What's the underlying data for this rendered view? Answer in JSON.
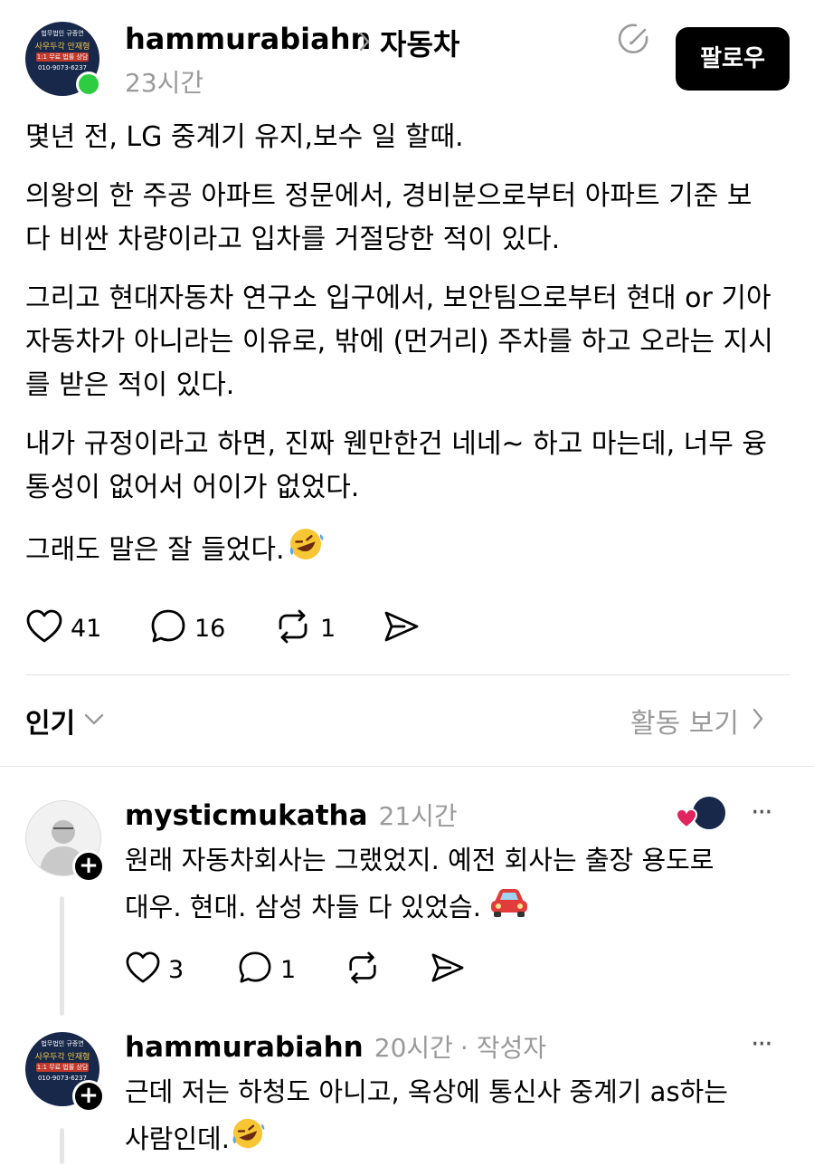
{
  "post": {
    "author": "hammurabiahn",
    "topic": "자동차",
    "time": "23시간",
    "follow_label": "팔로우",
    "avatar_text": {
      "logo": "법무법인 규종연",
      "name": "사우두각 안재형",
      "badge": "1:1 무료 법률 상담",
      "phone": "010-9073-6237"
    },
    "paragraphs": [
      "몇년 전, LG 중계기 유지,보수 일 할때.",
      "의왕의 한 주공 아파트 정문에서, 경비분으로부터 아파트 기준 보다 비싼 차량이라고 입차를 거절당한 적이 있다.",
      "그리고 현대자동차 연구소 입구에서, 보안팀으로부터 현대 or 기아자동차가 아니라는 이유로, 밖에 (먼거리) 주차를 하고 오라는 지시를 받은 적이 있다.",
      "내가 규정이라고 하면, 진짜 웬만한건 네네~ 하고 마는데, 너무 융통성이 없어서 어이가 없었다.",
      "그래도 말은 잘 들었다."
    ],
    "likes": "41",
    "comments": "16",
    "reposts": "1"
  },
  "sort": {
    "label": "인기",
    "activity_label": "활동 보기"
  },
  "replies": [
    {
      "author": "mysticmukatha",
      "time": "21시간",
      "text_line1": "원래 자동차회사는 그랬었지. 예전 회사는 출장 용도로",
      "text_line2": "대우. 현대. 삼성 차들 다 있었슴.",
      "likes": "3",
      "comments": "1",
      "more": "···"
    },
    {
      "author": "hammurabiahn",
      "time": "20시간",
      "author_tag": "· 작성자",
      "text_line1": "근데 저는 하청도 아니고, 옥상에 통신사 중계기 as하는",
      "text_line2": "사람인데.",
      "more": "···"
    }
  ],
  "icons": {
    "heart": "heart-icon",
    "comment": "comment-icon",
    "repost": "repost-icon",
    "share": "share-icon",
    "plus": "plus-icon",
    "chevron": "chevron-right-icon",
    "chevron_down": "chevron-down-icon"
  },
  "colors": {
    "online": "#2ecc40",
    "like_heart": "#e0245e",
    "grey_text": "#9a9a9a"
  }
}
